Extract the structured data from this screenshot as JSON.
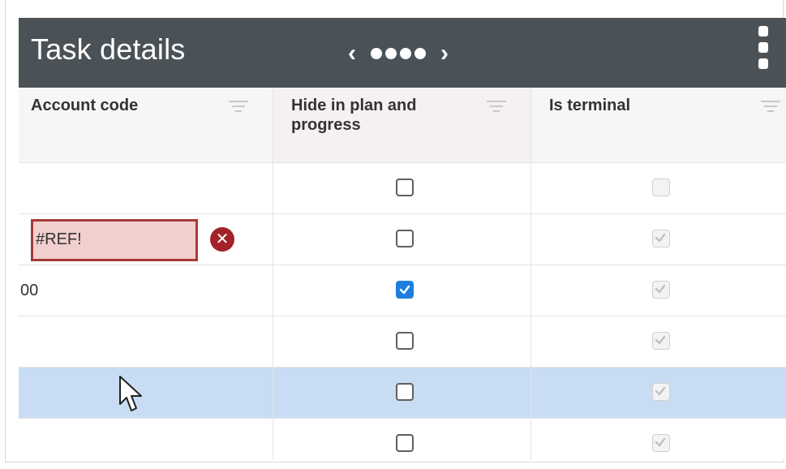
{
  "header": {
    "title": "Task details",
    "prev_label": "‹",
    "next_label": "›",
    "dot_count": 4,
    "menu_icon": "kebab-menu-icon"
  },
  "table": {
    "columns": [
      {
        "label": "Account code",
        "filter_icon": "filter-icon"
      },
      {
        "label": "Hide in plan and progress",
        "filter_icon": "filter-icon"
      },
      {
        "label": "Is terminal",
        "filter_icon": "filter-icon"
      }
    ],
    "rows": [
      {
        "account_code": "",
        "hide_in_plan": false,
        "is_terminal": false,
        "selected": false
      },
      {
        "account_code": "#REF!",
        "account_code_error": true,
        "hide_in_plan": false,
        "is_terminal": true,
        "selected": false
      },
      {
        "account_code": "00",
        "hide_in_plan": true,
        "is_terminal": true,
        "selected": false
      },
      {
        "account_code": "",
        "hide_in_plan": false,
        "is_terminal": true,
        "selected": false
      },
      {
        "account_code": "",
        "hide_in_plan": false,
        "is_terminal": true,
        "selected": true
      },
      {
        "account_code": "",
        "hide_in_plan": false,
        "is_terminal": true,
        "selected": false
      }
    ]
  },
  "colors": {
    "header_bg": "#4a5257",
    "selected_row": "#c8dcf3",
    "error_border": "#a63a3a",
    "error_fill": "#f2cfcf",
    "error_icon": "#a3222a",
    "checkbox_checked": "#1e7ee0"
  }
}
